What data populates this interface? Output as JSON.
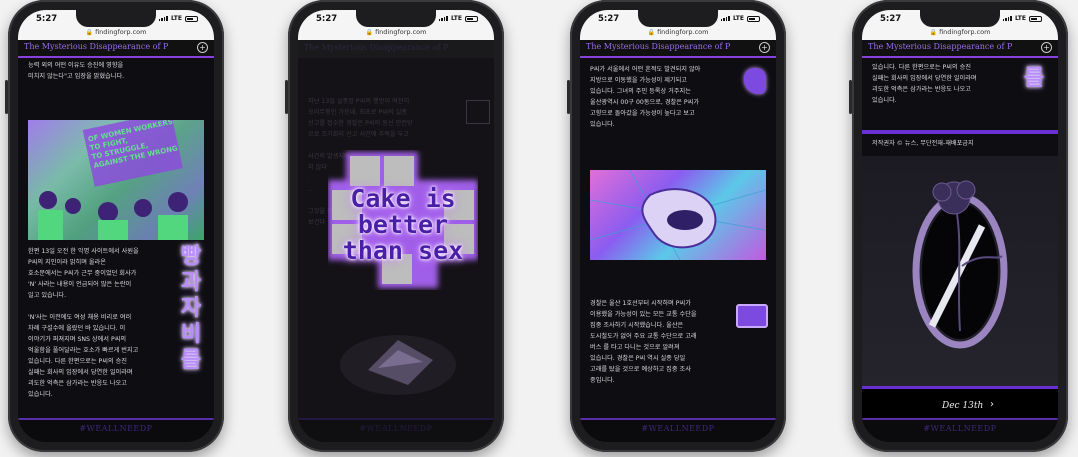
{
  "status": {
    "time": "5:27",
    "network": "LTE"
  },
  "browser": {
    "url": "findingforp.com"
  },
  "site": {
    "title": "The Mysterious Disappearance of P",
    "footer_tag": "#WEALLNEEDP"
  },
  "phone1": {
    "text_top": "능력 외의 어떤 이유도 승진에 영향을\n미치지 않는다\"고 입장을 밝혔습니다.",
    "protest_sign": "OF WOMEN WORKERS\nTO FIGHT,\nTO STRUGGLE,\nAGAINST THE WRONG",
    "text_body": "한편 13일 오전 한 익명 사이트에서 사원을\nP씨의 지인이라 밝히며 올라온\n호소문에서는 P씨가 근무 중이었던 회사가\n'N' 사라는 내용이 언급되어 많은 논란이\n일고 있습니다.\n\n'N'사는 이전에도 여성 채용 비리로 여러\n차례 구설수에 올랐던 바 있습니다. 이\n이야기가 퍼져지며 SNS 상에서 P씨의\n억울함을 풀어달라는 호소가 빠르게 번지고\n있습니다. 다른 한편으로는 P씨의 승진\n실패는 회사의 입장에서 당연한 일이라며\n괴도한 억측은 삼가라는 반응도 나오고\n있습니다.",
    "side_korean": [
      "빵",
      "과",
      "자",
      "비",
      "를"
    ]
  },
  "phone2": {
    "overlay_text": "Cake is better than sex",
    "bg_text": "지난 13일 실종된 P씨의 행방이 여전히\n오리무중인 가운데, 최초로 P씨의 실종\n신고를 접수한 경찰은 P씨의 동선 안전망\n으로 조기화되 신고 사건에 주목을 두고\n\n사건의 발생지에\n지 않다\n.\n..\n\n그것을 찾는 중\n보건다"
  },
  "phone3": {
    "text_top": "P씨가 서울에서 어떤 흔적도 발견되지 않아\n지방으로 이동했을 가능성이 제기되고\n있습니다. 그녀의 주민 등록상 거주지는\n울산광역시 00구 00동으로, 경찰은 P씨가\n고향으로 돌아갔을 가능성이 높다고 보고\n있습니다.",
    "text_body": "경찰은 울산 1호선부터 시작하며 P씨가\n이용했을 가능성이 있는 모든 교통 수단을\n집중 조사하기 시작했습니다. 울산은\n도시철도가 없어 주요 교통 수단으로 고래\n버스 를 타고 다니는 것으로 알려져\n있습니다. 경찰은 P씨 역시 실종 당일\n고래를 탔을 것으로 예상하고 집중 조사\n중입니다."
  },
  "phone4": {
    "text_top": "있습니다. 다른 한편으로는 P씨의 승진\n실패는 회사의 입장에서 당연한 일이라며\n괴도한 억측은 삼가라는 반응도 나오고\n있습니다.",
    "side_korean": "를",
    "copyright": "저작권자 © 뉴스, 무단전재-재배포금지",
    "date_label": "Dec 13th",
    "next_icon": "chevron-right"
  }
}
